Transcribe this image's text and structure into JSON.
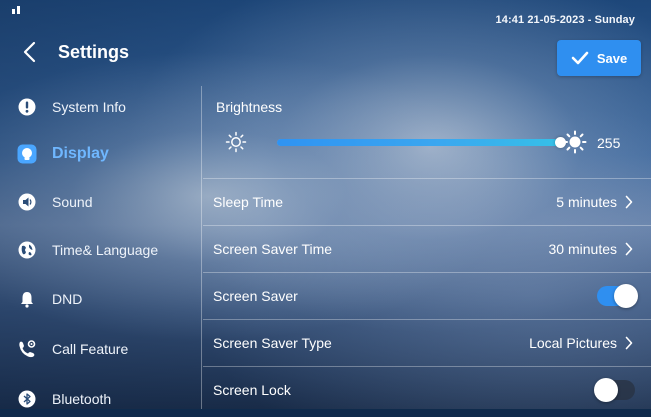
{
  "status_bar": {
    "clock": "14:41  21-05-2023 - Sunday"
  },
  "header": {
    "title": "Settings",
    "back_icon": "chevron-left-icon",
    "save_label": "Save",
    "save_icon": "check-icon"
  },
  "sidebar": {
    "items": [
      {
        "label": "System Info",
        "icon": "info-icon",
        "active": false
      },
      {
        "label": "Display",
        "icon": "display-icon",
        "active": true
      },
      {
        "label": "Sound",
        "icon": "speaker-icon",
        "active": false
      },
      {
        "label": "Time& Language",
        "icon": "globe-icon",
        "active": false
      },
      {
        "label": "DND",
        "icon": "bell-icon",
        "active": false
      },
      {
        "label": "Call Feature",
        "icon": "phone-settings-icon",
        "active": false
      },
      {
        "label": "Bluetooth",
        "icon": "bluetooth-icon",
        "active": false
      }
    ]
  },
  "display": {
    "brightness_label": "Brightness",
    "brightness_value": "255",
    "brightness_fraction": 1.0,
    "rows": [
      {
        "label": "Sleep Time",
        "value": "5 minutes",
        "type": "select"
      },
      {
        "label": "Screen Saver Time",
        "value": "30 minutes",
        "type": "select"
      },
      {
        "label": "Screen Saver",
        "type": "toggle",
        "on": true
      },
      {
        "label": "Screen Saver Type",
        "value": "Local Pictures",
        "type": "select"
      },
      {
        "label": "Screen Lock",
        "type": "toggle",
        "on": false
      }
    ]
  },
  "colors": {
    "accent": "#2f8ff0",
    "active_text": "#6fb7ff",
    "slider_fill": "#36c0e8"
  }
}
